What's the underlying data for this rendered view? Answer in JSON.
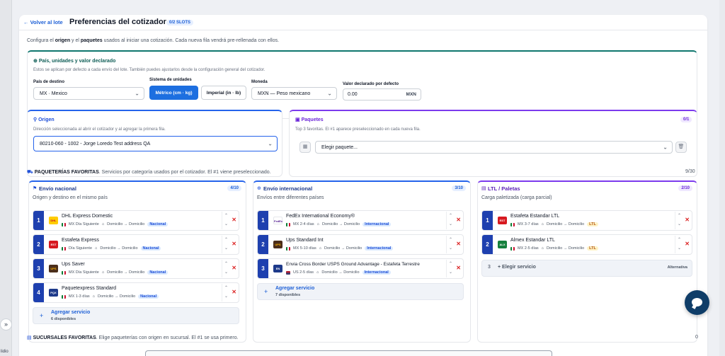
{
  "sidebar": {
    "bottom_text": "lidio",
    "expand_icon": "»"
  },
  "header": {
    "back_label": "Volver al lote",
    "title": "Preferencias del cotizador",
    "slots_badge": "0/2 SLOTS"
  },
  "intro": {
    "p1": "Configura el ",
    "b1": "origen",
    "p2": " y el ",
    "b2": "paquetes",
    "p3": " usados al iniciar una cotización. Cada nueva fila vendrá pre-rellenada con ellos."
  },
  "country_card": {
    "title": "País, unidades y valor declarado",
    "subtitle": "Estos se aplican por defecto a cada envío del lote. También puedes ajustarlos desde la configuración general del cotizador.",
    "dest_label": "País de destino",
    "dest_value": "MX · Mexico",
    "units_label": "Sistema de unidades",
    "metric_label": "Métrico (cm · kg)",
    "imperial_label": "Imperial (in · lb)",
    "currency_label": "Moneda",
    "currency_value": "MXN — Peso mexicano",
    "declared_label": "Valor declarado por defecto",
    "declared_value": "0.00",
    "declared_currency": "MXN"
  },
  "origin_card": {
    "title": "Origen",
    "subtitle": "Dirección seleccionada al abrir el cotizador y al agregar la primera fila.",
    "value": "80210-060 - 1002 - Jorge Loredo Test address QA"
  },
  "packages_card": {
    "title": "Paquetes",
    "subtitle": "Top 3 favoritas. El #1 aparece preseleccionado en cada nueva fila.",
    "count": "0/1",
    "select_placeholder": "Elegir paquete..."
  },
  "favorites": {
    "title": "PAQUETERÍAS FAVORITAS",
    "desc": ". Servicios por categoría usados por el cotizador. El #1 viene preseleccionado.",
    "count": "9/30"
  },
  "columns": {
    "national": {
      "title": "Envío nacional",
      "subtitle": "Origen y destino en el mismo país",
      "count": "4/10",
      "items": [
        {
          "num": "1",
          "name": "DHL Express Domestic",
          "meta1": "MX Día Siguiente",
          "meta2": "Domicilio → Domicilio",
          "tag": "Nacional",
          "logo_color": "#ffcc00",
          "logo_text": "DHL"
        },
        {
          "num": "2",
          "name": "Estafeta Express",
          "meta1": "Día Siguiente",
          "meta2": "Domicilio → Domicilio",
          "tag": "Nacional",
          "logo_color": "#d71920",
          "logo_text": "EST"
        },
        {
          "num": "3",
          "name": "Ups Saver",
          "meta1": "MX Día Siguiente",
          "meta2": "Domicilio → Domicilio",
          "tag": "Nacional",
          "logo_color": "#4b2e1a",
          "logo_text": "UPS"
        },
        {
          "num": "4",
          "name": "Paquetexpress Standard",
          "meta1": "MX 1-3 días",
          "meta2": "Domicilio → Domicilio",
          "tag": "Nacional",
          "logo_color": "#1e3a8a",
          "logo_text": "PQX"
        }
      ],
      "add_label": "Agregar servicio",
      "add_sub": "6 disponibles"
    },
    "international": {
      "title": "Envío internacional",
      "subtitle": "Envíos entre diferentes países",
      "count": "3/10",
      "items": [
        {
          "num": "1",
          "name": "FedEx International Economy®",
          "meta1": "MX 2-4 días",
          "meta2": "Domicilio → Domicilio",
          "tag": "Internacional",
          "logo_color": "#ffffff",
          "logo_text": "FedEx"
        },
        {
          "num": "2",
          "name": "Ups Standard Int",
          "meta1": "MX 5-10 días",
          "meta2": "Domicilio → Domicilio",
          "tag": "Internacional",
          "logo_color": "#4b2e1a",
          "logo_text": "UPS"
        },
        {
          "num": "3",
          "name": "Envia Cross Border USPS Ground Advantage - Estafeta Terrestre",
          "meta1": "US 2-5 días",
          "meta2": "Domicilio → Domicilio",
          "tag": "Internacional",
          "logo_color": "#1e3a8a",
          "logo_text": "EN"
        }
      ],
      "add_label": "Agregar servicio",
      "add_sub": "7 disponibles"
    },
    "ltl": {
      "title": "LTL / Paletas",
      "subtitle": "Carga paletizada (carga parcial)",
      "count": "2/10",
      "items": [
        {
          "num": "1",
          "name": "Estafeta Estandar LTL",
          "meta1": "MX 3-7 días",
          "meta2": "Domicilio → Domicilio",
          "tag": "LTL",
          "logo_color": "#d71920",
          "logo_text": "EST"
        },
        {
          "num": "2",
          "name": "Almex Estandar LTL",
          "meta1": "MX 2-5 días",
          "meta2": "Domicilio → Domicilio",
          "tag": "LTL",
          "logo_color": "#15803d",
          "logo_text": "ALX"
        }
      ],
      "choose_num": "3",
      "choose_label": "Elegir servicio",
      "choose_alt": "Alternativa"
    }
  },
  "branches": {
    "title": "SUCURSALES FAVORITAS",
    "desc": ". Elige paqueterías con origen en sucursal. El #1 se usa primero.",
    "count": "0"
  },
  "colors": {
    "accent": "#1d6fe0",
    "teal": "#0f766e",
    "purple": "#7c3aed",
    "danger": "#dc2626",
    "chat": "#0f3d68"
  }
}
